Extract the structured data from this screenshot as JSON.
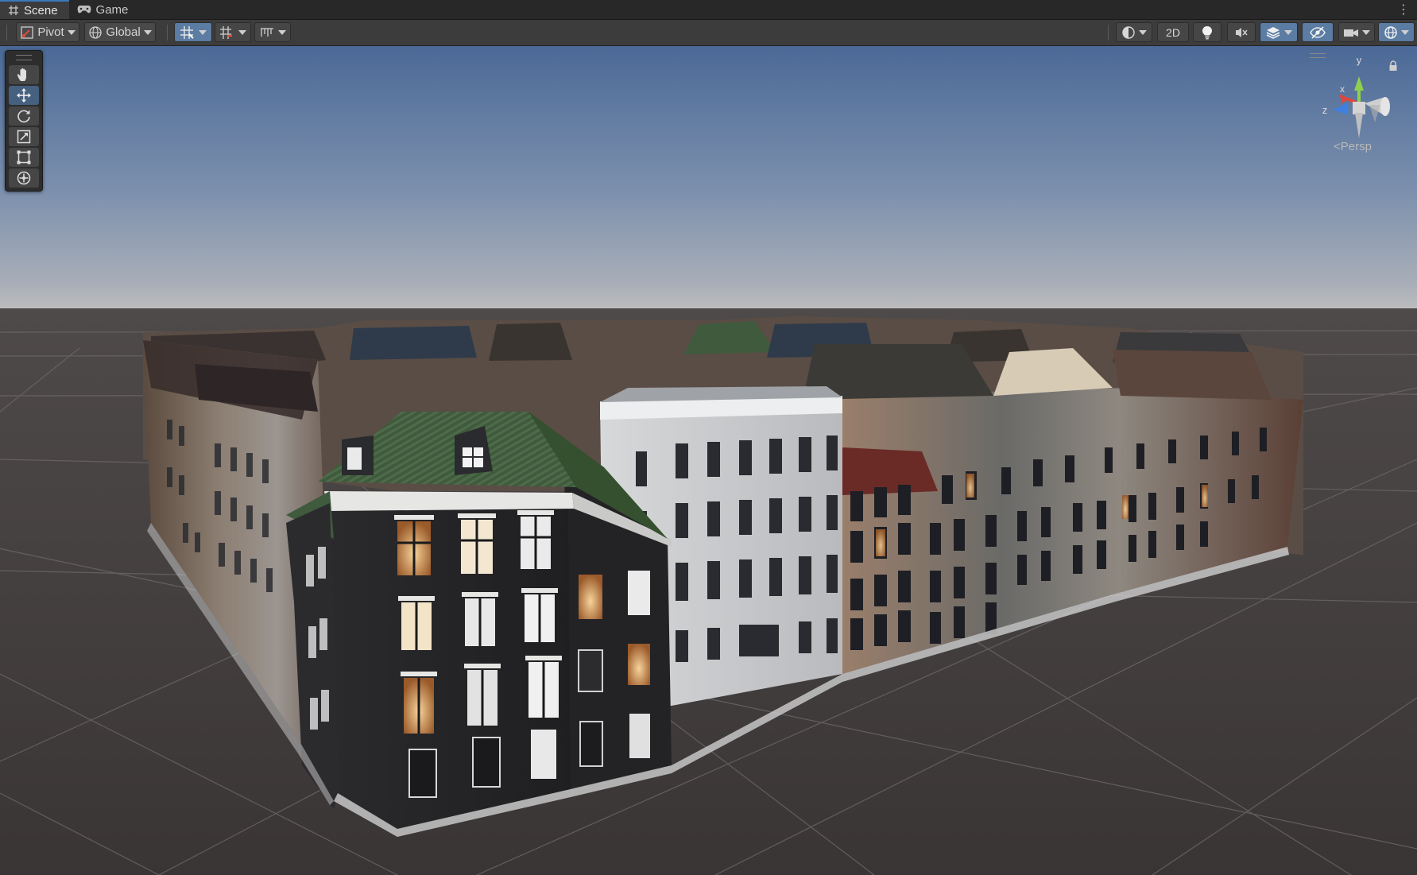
{
  "tabs": [
    {
      "label": "Scene",
      "icon": "scene-grid-icon",
      "active": true
    },
    {
      "label": "Game",
      "icon": "gamepad-icon",
      "active": false
    }
  ],
  "toolbar": {
    "pivot_label": "Pivot",
    "global_label": "Global",
    "mode_2d_label": "2D"
  },
  "tools": [
    {
      "name": "hand-tool",
      "icon": "hand-icon",
      "active": false
    },
    {
      "name": "move-tool",
      "icon": "move-arrows-icon",
      "active": true
    },
    {
      "name": "rotate-tool",
      "icon": "rotate-icon",
      "active": false
    },
    {
      "name": "scale-tool",
      "icon": "scale-icon",
      "active": false
    },
    {
      "name": "rect-tool",
      "icon": "rect-transform-icon",
      "active": false
    },
    {
      "name": "transform-tool",
      "icon": "transform-icon",
      "active": false
    }
  ],
  "gizmo": {
    "y_label": "y",
    "x_label": "x",
    "z_label": "z",
    "projection_label": "Persp",
    "y_color": "#8fd14f",
    "x_color": "#e0463c",
    "z_color": "#3f7fe0"
  },
  "colors": {
    "accent": "#3a79bb",
    "sky_top": "#4a6a96",
    "sky_horizon": "#b3b6bc",
    "ground": "#3b3736"
  }
}
